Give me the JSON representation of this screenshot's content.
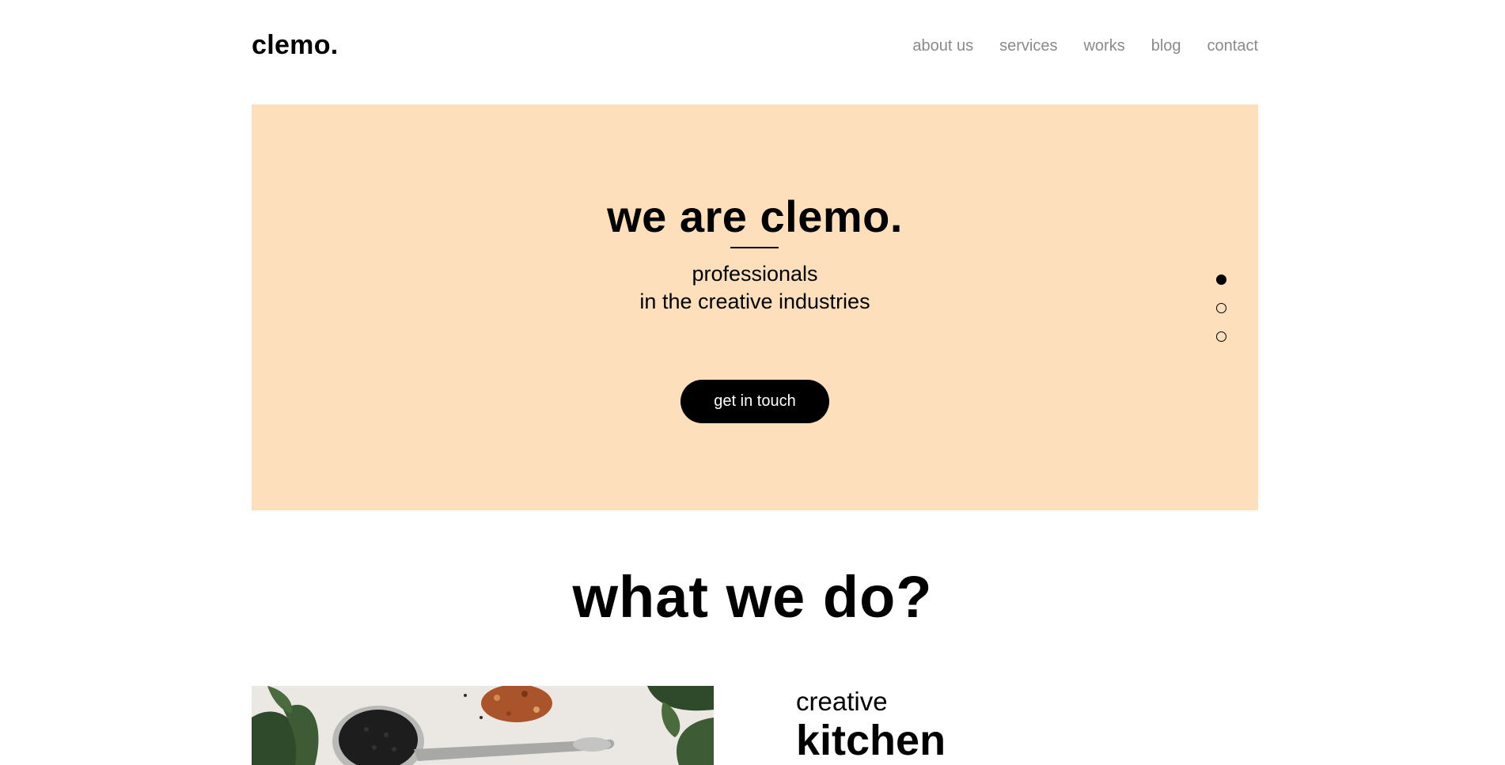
{
  "header": {
    "logo": "clemo.",
    "nav": [
      {
        "label": "about us"
      },
      {
        "label": "services"
      },
      {
        "label": "works"
      },
      {
        "label": "blog"
      },
      {
        "label": "contact"
      }
    ]
  },
  "hero": {
    "title": "we are clemo.",
    "subtitle_line1": "professionals",
    "subtitle_line2": "in the creative industries",
    "cta_label": "get in touch",
    "background_color": "#fddfbb",
    "slides": {
      "count": 3,
      "active": 1
    }
  },
  "section": {
    "title": "what we do?",
    "feature": {
      "kicker": "creative",
      "heading": "kitchen",
      "image": "spices-on-spoons-photo"
    }
  }
}
